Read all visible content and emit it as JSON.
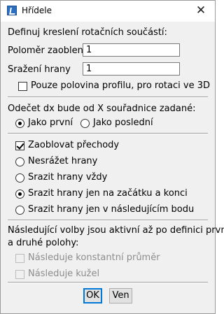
{
  "window": {
    "title": "Hřídele",
    "close_glyph": "✕"
  },
  "section1": {
    "heading": "Definuj kreslení rotačních součástí:",
    "radius_label": "Poloměr zaoblení",
    "radius_value": "1",
    "chamfer_label": "Sražení hrany",
    "chamfer_value": "1",
    "half_profile_label": "Pouze polovina profilu, pro rotaci ve 3D",
    "half_profile_checked": false
  },
  "section2": {
    "heading": "Odečet dx bude od X souřadnice zadané:",
    "options": [
      {
        "label": "Jako první",
        "selected": true
      },
      {
        "label": "Jako poslední",
        "selected": false
      }
    ]
  },
  "section3": {
    "round_transitions_label": "Zaoblovat přechody",
    "round_transitions_checked": true,
    "options": [
      {
        "label": "Nesrážet hrany",
        "selected": false
      },
      {
        "label": "Srazit hrany vždy",
        "selected": false
      },
      {
        "label": "Srazit hrany jen na začátku a konci",
        "selected": true
      },
      {
        "label": "Srazit hrany jen v následujícím bodu",
        "selected": false
      }
    ]
  },
  "section4": {
    "heading_line1": "Následující volby jsou aktivní až po definici první",
    "heading_line2": "a druhé polohy:",
    "follow_diameter_label": "Následuje konstantní průměr",
    "follow_cone_label": "Následuje kužel"
  },
  "buttons": {
    "ok": "OK",
    "cancel": "Ven"
  }
}
